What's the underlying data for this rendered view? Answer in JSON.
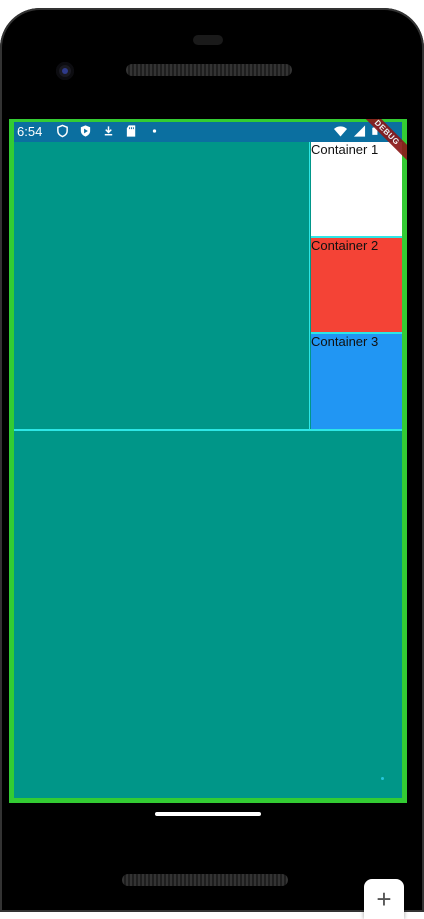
{
  "status_bar": {
    "time": "6:54",
    "left_icons": [
      "shield-outline-icon",
      "play-shield-icon",
      "download-icon",
      "sd-card-icon",
      "dot-icon"
    ],
    "right_icons": [
      "wifi-icon",
      "signal-icon",
      "battery-icon"
    ],
    "background_color": "#0b6fa0"
  },
  "debug_banner": {
    "label": "DEBUG"
  },
  "containers": [
    {
      "label": "Container 1",
      "color": "#ffffff"
    },
    {
      "label": "Container 2",
      "color": "#f44336"
    },
    {
      "label": "Container 3",
      "color": "#2196f3"
    }
  ],
  "colors": {
    "app_background": "#009688",
    "frame_border": "#33cc33",
    "divider": "#2ee6e6"
  },
  "zoom_button": {
    "label": "+"
  }
}
